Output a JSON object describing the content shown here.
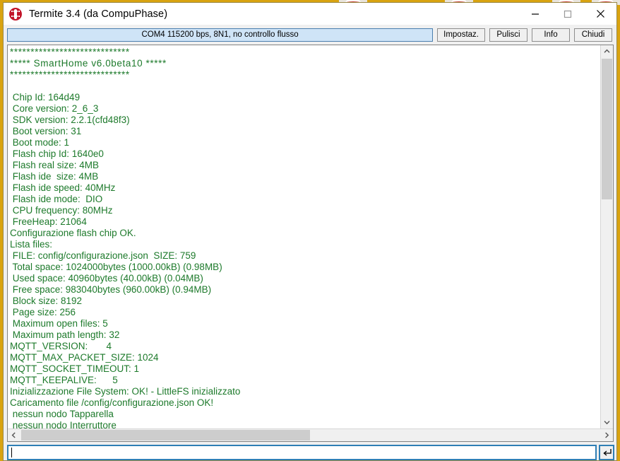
{
  "window": {
    "title": "Termite 3.4 (da CompuPhase)",
    "app_icon": "termite-bug-icon",
    "controls": {
      "minimize": "minimize-icon",
      "maximize": "maximize-icon",
      "close": "close-icon"
    }
  },
  "connection": {
    "status": "COM4 115200 bps, 8N1, no controllo flusso"
  },
  "toolbar": {
    "settings_label": "Impostaz.",
    "clear_label": "Pulisci",
    "info_label": "Info",
    "close_label": "Chiudi"
  },
  "terminal": {
    "text_color": "#1d7a2b",
    "lines": [
      "*****************************",
      "***** SmartHome v6.0beta10 *****",
      "*****************************",
      "",
      " Chip Id: 164d49",
      " Core version: 2_6_3",
      " SDK version: 2.2.1(cfd48f3)",
      " Boot version: 31",
      " Boot mode: 1",
      " Flash chip Id: 1640e0",
      " Flash real size: 4MB",
      " Flash ide  size: 4MB",
      " Flash ide speed: 40MHz",
      " Flash ide mode:  DIO",
      " CPU frequency: 80MHz",
      " FreeHeap: 21064",
      "Configurazione flash chip OK.",
      "Lista files:",
      " FILE: config/configurazione.json  SIZE: 759",
      " Total space: 1024000bytes (1000.00kB) (0.98MB)",
      " Used space: 40960bytes (40.00kB) (0.04MB)",
      " Free space: 983040bytes (960.00kB) (0.94MB)",
      " Block size: 8192",
      " Page size: 256",
      " Maximum open files: 5",
      " Maximum path length: 32",
      "MQTT_VERSION:       4",
      "MQTT_MAX_PACKET_SIZE: 1024",
      "MQTT_SOCKET_TIMEOUT: 1",
      "MQTT_KEEPALIVE:      5",
      "Inizializzazione File System: OK! - LittleFS inizializzato",
      "Caricamento file /config/configurazione.json OK!",
      " nessun nodo Tapparella",
      " nessun nodo Interruttore"
    ]
  },
  "scrollbars": {
    "vertical_up": "chevron-up-icon",
    "vertical_down": "chevron-down-icon",
    "horizontal_left": "chevron-left-icon",
    "horizontal_right": "chevron-right-icon"
  },
  "command": {
    "value": "",
    "placeholder": "",
    "send_icon": "enter-return-icon"
  }
}
